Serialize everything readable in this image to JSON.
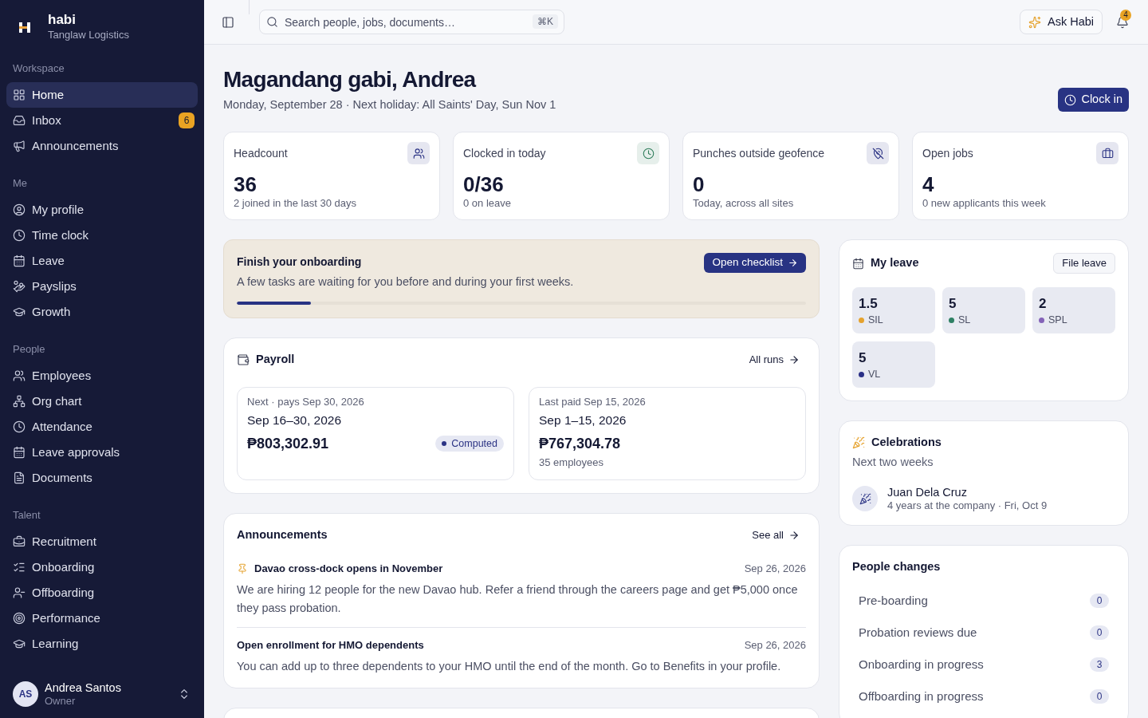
{
  "sidebar": {
    "brand": {
      "name": "habi",
      "organization": "Tanglaw Logistics"
    },
    "sections": [
      {
        "title": "Workspace",
        "items": [
          {
            "label": "Home",
            "selected": true
          },
          {
            "label": "Inbox",
            "selected": false,
            "badge": "6"
          },
          {
            "label": "Announcements",
            "selected": false
          }
        ]
      },
      {
        "title": "Me",
        "items": [
          {
            "label": "My profile",
            "selected": false
          },
          {
            "label": "Time clock",
            "selected": false
          },
          {
            "label": "Leave",
            "selected": false
          },
          {
            "label": "Payslips",
            "selected": false
          },
          {
            "label": "Growth",
            "selected": false
          }
        ]
      },
      {
        "title": "People",
        "items": [
          {
            "label": "Employees",
            "selected": false
          },
          {
            "label": "Org chart",
            "selected": false
          },
          {
            "label": "Attendance",
            "selected": false
          },
          {
            "label": "Leave approvals",
            "selected": false
          },
          {
            "label": "Documents",
            "selected": false
          }
        ]
      },
      {
        "title": "Talent",
        "items": [
          {
            "label": "Recruitment",
            "selected": false
          },
          {
            "label": "Onboarding",
            "selected": false
          },
          {
            "label": "Offboarding",
            "selected": false
          },
          {
            "label": "Performance",
            "selected": false
          },
          {
            "label": "Learning",
            "selected": false
          }
        ]
      }
    ],
    "user": {
      "initials": "AS",
      "name": "Andrea Santos",
      "role": "Owner"
    }
  },
  "top_bar": {
    "search": {
      "placeholder": "Search people, jobs, documents…",
      "shortcut": "⌘K"
    },
    "ask_button": "Ask Habi",
    "notifications_badge": "4"
  },
  "header": {
    "greeting": "Magandang gabi, Andrea",
    "subtitle": "Monday, September 28 · Next holiday: All Saints' Day, Sun Nov 1",
    "clock_in_button": "Clock in"
  },
  "stats": [
    {
      "label": "Headcount",
      "value": "36",
      "note": "2 joined in the last 30 days",
      "color": "#2b3384"
    },
    {
      "label": "Clocked in today",
      "value": "0/36",
      "note": "0 on leave",
      "color": "#2f7d5b"
    },
    {
      "label": "Punches outside geofence",
      "value": "0",
      "note": "Today, across all sites",
      "color": "#2b3384"
    },
    {
      "label": "Open jobs",
      "value": "4",
      "note": "0 new applicants this week",
      "color": "#2b3384"
    }
  ],
  "onboarding": {
    "title": "Finish your onboarding",
    "description": "A few tasks are waiting for you before and during your first weeks.",
    "button": "Open checklist",
    "level": 0.13
  },
  "payroll": {
    "title": "Payroll",
    "link": "All runs",
    "runs": [
      {
        "caption": "Next · pays Sep 30, 2026",
        "period": "Sep 16–30, 2026",
        "amount": "₱803,302.91",
        "status": "Computed"
      },
      {
        "caption": "Last paid Sep 15, 2026",
        "period": "Sep 1–15, 2026",
        "amount": "₱767,304.78",
        "note": "35 employees"
      }
    ]
  },
  "announcements": {
    "title": "Announcements",
    "link": "See all",
    "items": [
      {
        "title": "Davao cross-dock opens in November",
        "date": "Sep 26, 2026",
        "pinned": true,
        "body": "We are hiring 12 people for the new Davao hub. Refer a friend through the careers page and get ₱5,000 once they pass probation."
      },
      {
        "title": "Open enrollment for HMO dependents",
        "date": "Sep 26, 2026",
        "pinned": false,
        "body": "You can add up to three dependents to your HMO until the end of the month. Go to Benefits in your profile."
      }
    ]
  },
  "my_leave": {
    "title": "My leave",
    "button": "File leave",
    "balances": [
      {
        "value": "1.5",
        "label": "SIL",
        "color": "#e5a22e"
      },
      {
        "value": "5",
        "label": "SL",
        "color": "#2e8064"
      },
      {
        "value": "2",
        "label": "SPL",
        "color": "#8463b8"
      },
      {
        "value": "5",
        "label": "VL",
        "color": "#2a2f86"
      }
    ]
  },
  "celebrations": {
    "title": "Celebrations",
    "subtitle": "Next two weeks",
    "items": [
      {
        "name": "Juan Dela Cruz",
        "detail": "4 years at the company · Fri, Oct 9"
      }
    ]
  },
  "people_changes": {
    "title": "People changes",
    "rows": [
      {
        "label": "Pre-boarding",
        "count": "0"
      },
      {
        "label": "Probation reviews due",
        "count": "0"
      },
      {
        "label": "Onboarding in progress",
        "count": "3"
      },
      {
        "label": "Offboarding in progress",
        "count": "0"
      }
    ]
  }
}
